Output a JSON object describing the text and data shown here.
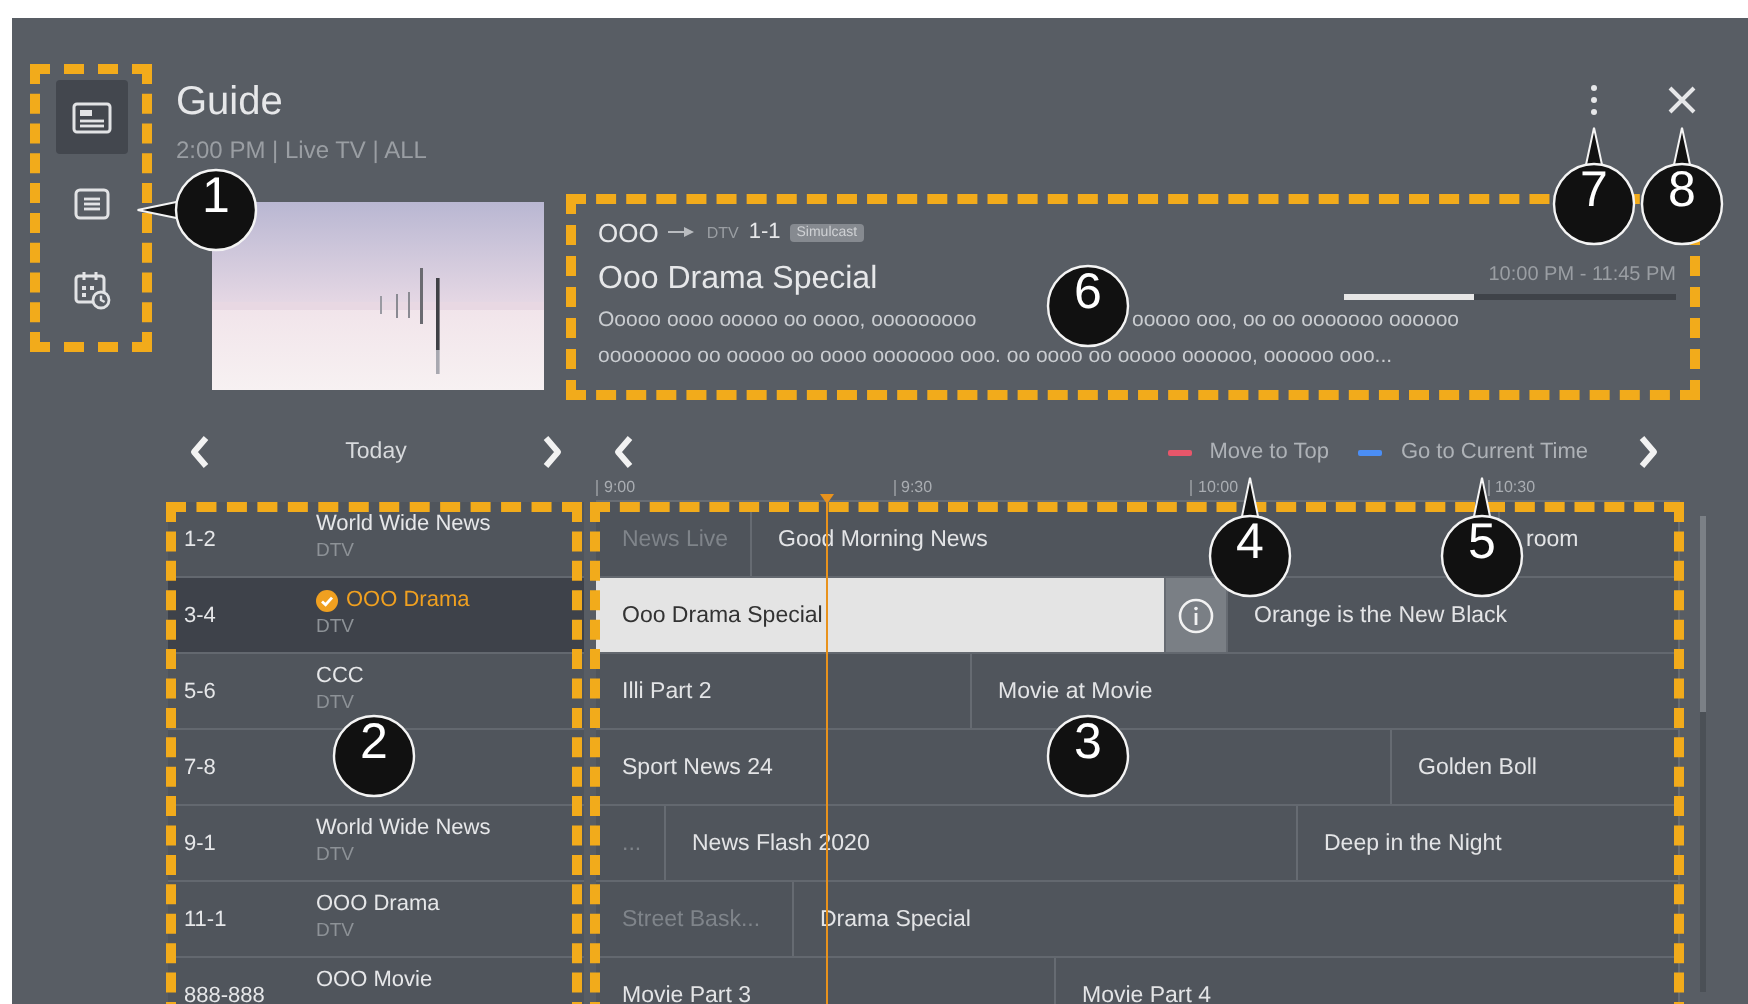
{
  "sidebar": {
    "items": [
      {
        "kind": "guide",
        "selected": true
      },
      {
        "kind": "list",
        "selected": false
      },
      {
        "kind": "schedule",
        "selected": false
      }
    ]
  },
  "header": {
    "title": "Guide",
    "subtitle": "2:00 PM | Live TV | ALL"
  },
  "program_info": {
    "channel_name": "OOO",
    "source": "DTV",
    "channel_number": "1-1",
    "badge": "Simulcast",
    "title": "Ooo Drama Special",
    "time": "10:00 PM - 11:45 PM",
    "level": 0.39,
    "description": [
      {
        "parts": [
          "Ooooo oooo ooooo oo oooo, ooooooooo",
          "ooooo ooo, oo oo ooooooo oooooo"
        ]
      },
      {
        "parts": [
          "oooooooo oo ooooo oo oooo ooooooo ooo. oo oooo oo ooooo oooooo, oooooo ooo..."
        ]
      }
    ]
  },
  "navigator": {
    "date": "Today",
    "legend": [
      {
        "label": "Move to Top",
        "color": "#e8566a"
      },
      {
        "label": "Go to Current Time",
        "color": "#4b8ef5"
      }
    ]
  },
  "timeline": {
    "ticks": [
      "9:00",
      "9:30",
      "10:00",
      "10:30"
    ]
  },
  "channels": [
    {
      "number": "1-2",
      "name": "World Wide News",
      "type": "DTV",
      "selected": false,
      "checked": false
    },
    {
      "number": "3-4",
      "name": "OOO Drama",
      "type": "DTV",
      "selected": true,
      "checked": true
    },
    {
      "number": "5-6",
      "name": "CCC",
      "type": "DTV",
      "selected": false,
      "checked": false
    },
    {
      "number": "7-8",
      "selected": false
    },
    {
      "number": "9-1",
      "name": "World Wide News",
      "type": "DTV",
      "selected": false,
      "checked": false
    },
    {
      "number": "11-1",
      "name": "OOO Drama",
      "type": "DTV",
      "selected": false,
      "checked": false
    },
    {
      "number": "888-888",
      "name": "OOO Movie",
      "selected": false,
      "checked": false
    }
  ],
  "schedule": [
    {
      "programs": [
        {
          "kind": "program",
          "title": "News Live",
          "past": true,
          "selected": false
        },
        {
          "kind": "program",
          "title": "Good Morning News",
          "past": false,
          "selected": false
        },
        {
          "kind": "program",
          "title": "room",
          "past": false,
          "selected": false
        }
      ]
    },
    {
      "programs": [
        {
          "kind": "program",
          "title": "Ooo Drama Special",
          "past": false,
          "selected": true
        },
        {
          "kind": "info"
        },
        {
          "kind": "program",
          "title": "Orange is the New Black",
          "past": false,
          "selected": false
        }
      ]
    },
    {
      "programs": [
        {
          "kind": "program",
          "title": "Illi Part 2",
          "past": false,
          "selected": false
        },
        {
          "kind": "program",
          "title": "Movie at Movie",
          "past": false,
          "selected": false
        }
      ]
    },
    {
      "programs": [
        {
          "kind": "program",
          "title": "Sport News 24",
          "past": false,
          "selected": false
        },
        {
          "kind": "program",
          "title": "Golden Boll",
          "past": false,
          "selected": false
        }
      ]
    },
    {
      "programs": [
        {
          "kind": "program",
          "title": "...",
          "past": true,
          "selected": false
        },
        {
          "kind": "program",
          "title": "News Flash 2020",
          "past": false,
          "selected": false
        },
        {
          "kind": "program",
          "title": "Deep in the Night",
          "past": false,
          "selected": false
        }
      ]
    },
    {
      "programs": [
        {
          "kind": "program",
          "title": "Street Bask...",
          "past": true,
          "selected": false
        },
        {
          "kind": "program",
          "title": "Drama Special",
          "past": false,
          "selected": false
        }
      ]
    },
    {
      "programs": [
        {
          "kind": "program",
          "title": "Movie Part 3",
          "past": false,
          "selected": false
        },
        {
          "kind": "program",
          "title": "Movie Part 4",
          "past": false,
          "selected": false
        }
      ]
    }
  ],
  "callouts": [
    {
      "label": "1"
    },
    {
      "label": "2"
    },
    {
      "label": "3"
    },
    {
      "label": "4"
    },
    {
      "label": "5"
    },
    {
      "label": "6"
    },
    {
      "label": "7"
    },
    {
      "label": "8"
    }
  ]
}
